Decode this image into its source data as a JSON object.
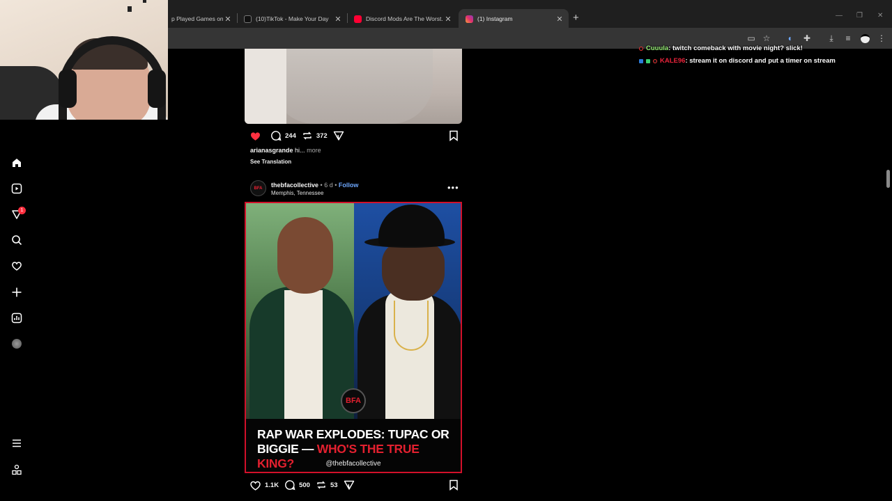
{
  "browser": {
    "tabs": [
      {
        "title": "p Played Games on K",
        "favicon": "kick-icon",
        "active": false
      },
      {
        "title": "(10)TikTok - Make Your Day",
        "favicon": "tiktok-icon",
        "active": false
      },
      {
        "title": "Discord Mods Are The Worst...",
        "favicon": "youtube-icon",
        "active": false
      },
      {
        "title": "(1) Instagram",
        "favicon": "instagram-icon",
        "active": true
      }
    ],
    "new_tab": "+"
  },
  "nav": {
    "notification_count": "1"
  },
  "post1": {
    "comments": "244",
    "reposts": "372",
    "caption_user": "arianasgrande",
    "caption_text": "hi...",
    "more": "more",
    "see_translation": "See Translation"
  },
  "post2": {
    "username": "thebfacollective",
    "age": "6 d",
    "follow": "Follow",
    "location": "Memphis, Tennessee",
    "logo_text": "BFA",
    "avatar_text": "BFA",
    "headline_white": "RAP WAR EXPLODES: TUPAC OR BIGGIE —",
    "headline_red": "WHO'S THE TRUE KING?",
    "handle": "@thebfacollective",
    "likes": "1.1K",
    "comments": "500",
    "reposts": "53"
  },
  "chat": [
    {
      "user": "Cuuula",
      "message": ": twitch comeback with movie night? slick!",
      "color": "#9bf27a"
    },
    {
      "user": "KALE96",
      "message": ": stream it on discord and put a timer on stream",
      "color": "#e8233a"
    }
  ],
  "colors": {
    "accent_red": "#e3202f",
    "like_red": "#ff3040",
    "follow_blue": "#6ea8ff"
  }
}
